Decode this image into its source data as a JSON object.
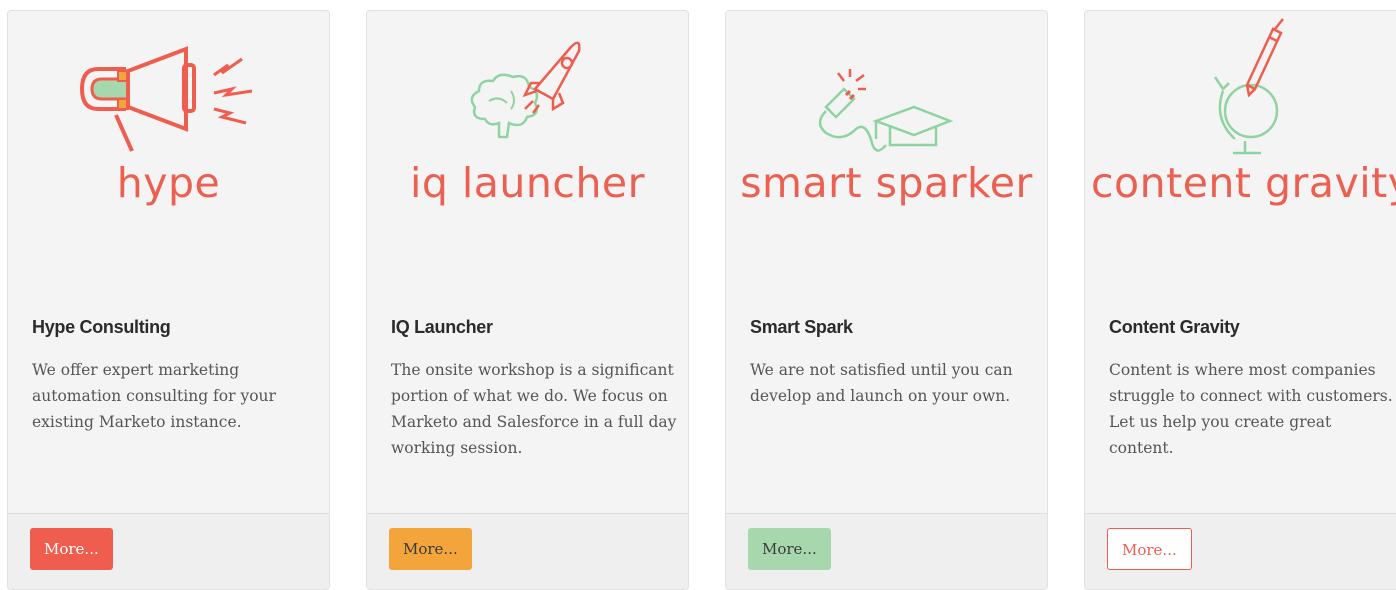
{
  "colors": {
    "red": "#ef5d4f",
    "orange": "#f3a53c",
    "green": "#a7d8ad",
    "mint": "#8fd3a0"
  },
  "cards": [
    {
      "logo_text": "hype",
      "logo_icon": "megaphone-magnet-icon",
      "title": "Hype Consulting",
      "text": "We offer expert marketing automation consulting for your existing Marketo instance.",
      "button": "More..."
    },
    {
      "logo_text": "iq launcher",
      "logo_icon": "rocket-brain-icon",
      "title": "IQ Launcher",
      "text": "The onsite workshop is a significant portion of what we do. We focus on Marketo and Salesforce in a full day working session.",
      "button": "More..."
    },
    {
      "logo_text": "smart sparker",
      "logo_icon": "plug-graduation-cap-icon",
      "title": "Smart Spark",
      "text": "We are not satisfied until you can develop and launch on your own.",
      "button": "More..."
    },
    {
      "logo_text": "content gravity",
      "logo_icon": "pen-globe-icon",
      "title": "Content Gravity",
      "text": "Content is where most companies struggle to connect with customers. Let us help you create great content.",
      "button": "More..."
    }
  ]
}
